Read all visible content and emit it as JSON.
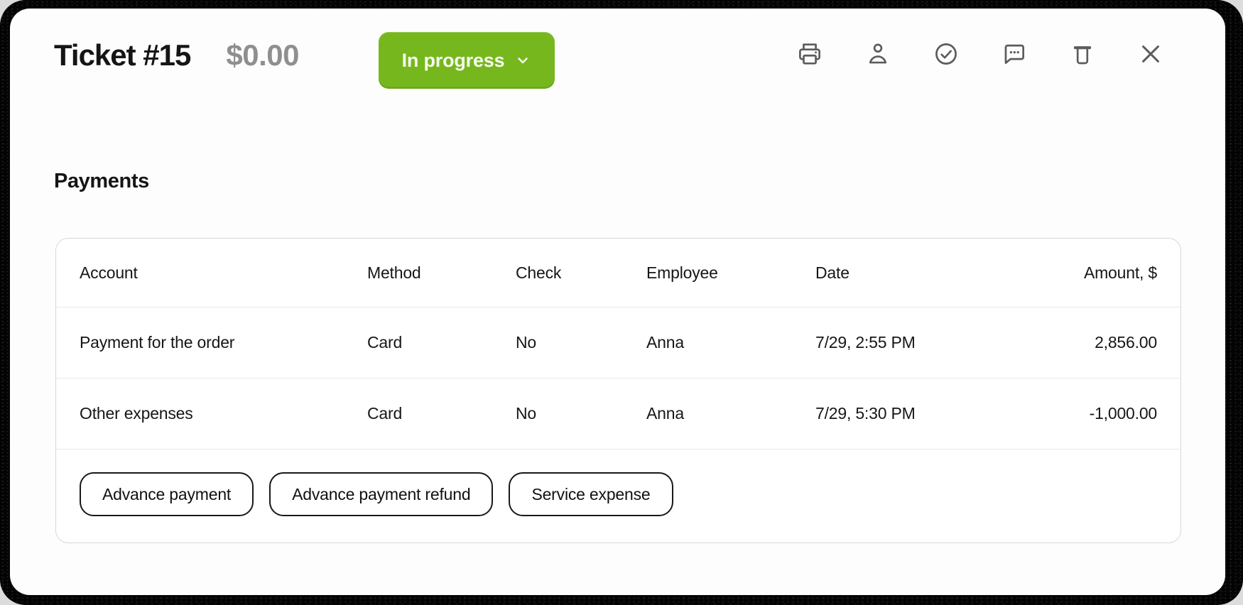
{
  "window": {
    "title": "Ticket #15",
    "total": "$0.00",
    "status": {
      "label": "In progress"
    },
    "toolbar_icons": [
      "printer",
      "user",
      "check-circle",
      "comment",
      "trash",
      "close"
    ]
  },
  "payments": {
    "heading": "Payments",
    "table": {
      "columns": {
        "account": "Account",
        "method": "Method",
        "check": "Check",
        "employee": "Employee",
        "date": "Date",
        "amount": "Amount, $"
      },
      "rows": [
        {
          "account": "Payment for the order",
          "method": "Card",
          "check": "No",
          "employee": "Anna",
          "date": "7/29, 2:55 PM",
          "amount": "2,856.00"
        },
        {
          "account": "Other expenses",
          "method": "Card",
          "check": "No",
          "employee": "Anna",
          "date": "7/29, 5:30 PM",
          "amount": "-1,000.00"
        }
      ],
      "actions": {
        "advance_payment": "Advance payment",
        "advance_payment_refund": "Advance payment refund",
        "service_expense": "Service expense"
      }
    }
  },
  "colors": {
    "status_green": "#76b71e",
    "status_text": "#f7fcee",
    "icon_gray": "#5c5c5c",
    "table_border": "#d8d8d8"
  }
}
